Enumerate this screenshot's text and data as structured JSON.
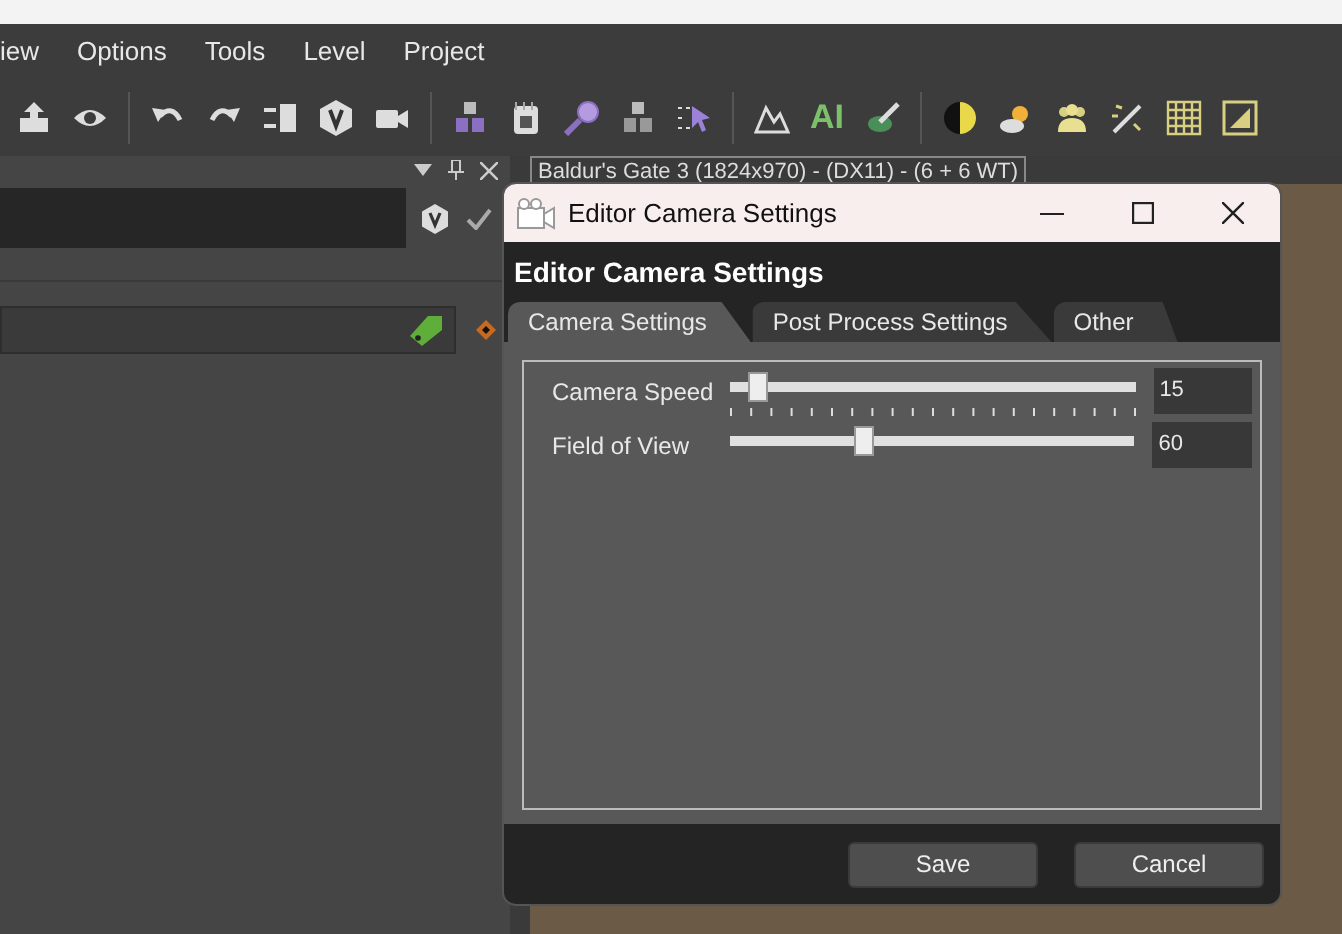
{
  "menu": [
    "iew",
    "Options",
    "Tools",
    "Level",
    "Project"
  ],
  "toolbar": [
    {
      "kind": "icon"
    },
    {
      "kind": "icon"
    },
    {
      "kind": "sep"
    },
    {
      "kind": "icon"
    },
    {
      "kind": "icon"
    },
    {
      "kind": "icon"
    },
    {
      "kind": "icon"
    },
    {
      "kind": "icon"
    },
    {
      "kind": "sep"
    },
    {
      "kind": "icon"
    },
    {
      "kind": "icon"
    },
    {
      "kind": "icon"
    },
    {
      "kind": "icon"
    },
    {
      "kind": "icon"
    },
    {
      "kind": "sep"
    },
    {
      "kind": "icon"
    },
    {
      "kind": "text",
      "label": "AI"
    },
    {
      "kind": "icon"
    },
    {
      "kind": "sep"
    },
    {
      "kind": "icon"
    },
    {
      "kind": "icon"
    },
    {
      "kind": "icon"
    },
    {
      "kind": "icon"
    },
    {
      "kind": "icon"
    },
    {
      "kind": "icon"
    }
  ],
  "viewport": {
    "title": "Baldur's Gate 3 (1824x970) - (DX11) - (6 + 6 WT)"
  },
  "dialog": {
    "title": "Editor Camera Settings",
    "header": "Editor Camera Settings",
    "tabs": [
      {
        "label": "Camera Settings",
        "selected": true
      },
      {
        "label": "Post Process Settings",
        "selected": false
      },
      {
        "label": "Other",
        "selected": false
      }
    ],
    "sliders": [
      {
        "kind": "ticked",
        "label": "Camera Speed",
        "level": 0.05,
        "value": "15"
      },
      {
        "kind": "plain",
        "label": "Field of View",
        "level": 0.32,
        "value": "60"
      }
    ],
    "buttons": [
      "Save",
      "Cancel"
    ]
  }
}
